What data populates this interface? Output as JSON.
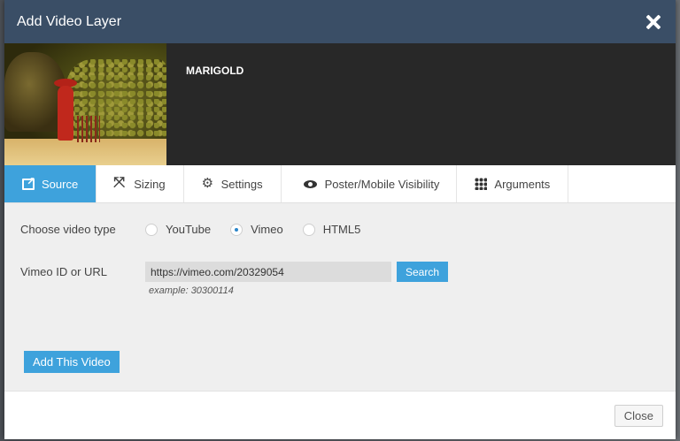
{
  "dialog": {
    "title": "Add Video Layer",
    "close_icon": "close-icon"
  },
  "preview": {
    "video_name": "MARIGOLD"
  },
  "tabs": [
    {
      "label": "Source",
      "icon": "source-icon",
      "active": true
    },
    {
      "label": "Sizing",
      "icon": "sizing-icon",
      "active": false
    },
    {
      "label": "Settings",
      "icon": "gear-icon",
      "active": false
    },
    {
      "label": "Poster/Mobile Visibility",
      "icon": "eye-icon",
      "active": false
    },
    {
      "label": "Arguments",
      "icon": "grid-icon",
      "active": false
    }
  ],
  "source": {
    "video_type_label": "Choose video type",
    "options": [
      {
        "label": "YouTube",
        "selected": false
      },
      {
        "label": "Vimeo",
        "selected": true
      },
      {
        "label": "HTML5",
        "selected": false
      }
    ],
    "id_label": "Vimeo ID or URL",
    "id_value": "https://vimeo.com/20329054",
    "search_label": "Search",
    "example": "example: 30300114",
    "add_label": "Add This Video"
  },
  "footer": {
    "close_label": "Close"
  },
  "colors": {
    "titlebar": "#3a4e66",
    "accent": "#3ea2dc",
    "preview_bg": "#282828"
  }
}
